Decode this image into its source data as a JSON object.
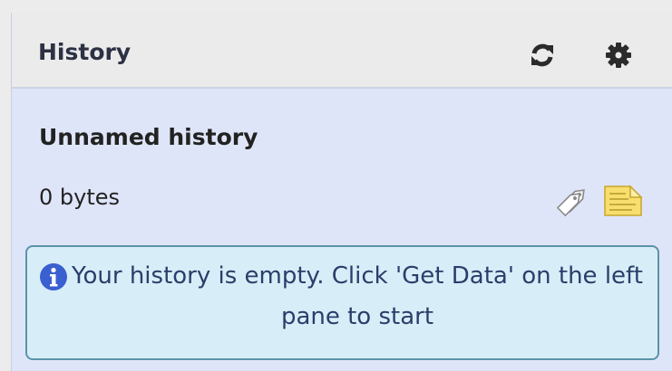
{
  "panel": {
    "title": "History",
    "icons": [
      "refresh-icon",
      "gear-icon"
    ]
  },
  "history": {
    "name": "Unnamed history",
    "size": "0 bytes",
    "icons": [
      "tags-icon",
      "annotation-icon"
    ]
  },
  "message": {
    "icon": "info-icon",
    "text": "Your history is empty. Click 'Get Data' on the left pane to start"
  },
  "colors": {
    "panel_bg": "#dfe5f9",
    "header_bg": "#ebebeb",
    "info_bg": "#d7eef8",
    "info_border": "#5b93a8",
    "info_icon": "#3a5fd0"
  }
}
